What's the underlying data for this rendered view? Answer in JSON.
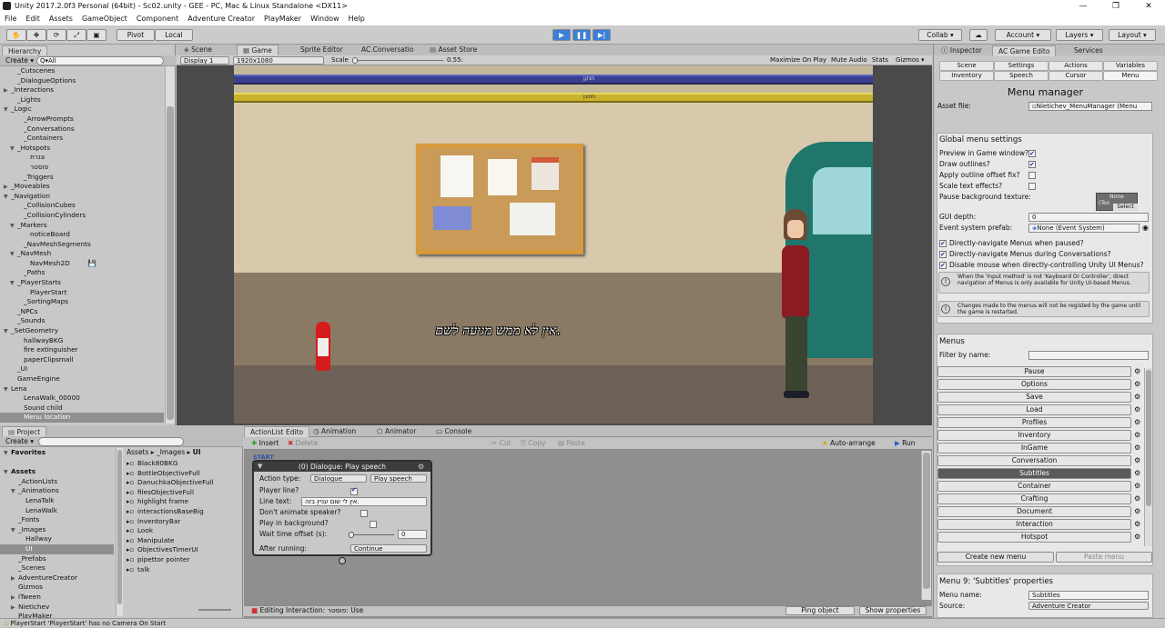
{
  "window": {
    "title": "Unity 2017.2.0f3 Personal (64bit) - Sc02.unity - GEE - PC, Mac & Linux Standalone <DX11>",
    "minimize": "—",
    "maximize": "❐",
    "close": "✕"
  },
  "menubar": [
    "File",
    "Edit",
    "Assets",
    "GameObject",
    "Component",
    "Adventure Creator",
    "PlayMaker",
    "Window",
    "Help"
  ],
  "toolbar": {
    "pivot": "Pivot",
    "local": "Local",
    "collab": "Collab ▾",
    "account": "Account ▾",
    "layers": "Layers ▾",
    "layout": "Layout ▾"
  },
  "hierarchy": {
    "tab": "Hierarchy",
    "create": "Create ▾",
    "search_placeholder": "Q▾All",
    "items": [
      {
        "indent": 1,
        "arrow": "",
        "label": "_Cutscenes"
      },
      {
        "indent": 1,
        "arrow": "",
        "label": "_DialogueOptions"
      },
      {
        "indent": 0,
        "arrow": "▶",
        "label": "_Interactions"
      },
      {
        "indent": 1,
        "arrow": "",
        "label": "_Lights"
      },
      {
        "indent": 0,
        "arrow": "▼",
        "label": "_Logic"
      },
      {
        "indent": 2,
        "arrow": "",
        "label": "_ArrowPrompts"
      },
      {
        "indent": 2,
        "arrow": "",
        "label": "_Conversations"
      },
      {
        "indent": 2,
        "arrow": "",
        "label": "_Containers"
      },
      {
        "indent": 1,
        "arrow": "▼",
        "label": "_Hotspots"
      },
      {
        "indent": 3,
        "arrow": "",
        "label": "צנרת"
      },
      {
        "indent": 3,
        "arrow": "",
        "label": "פוסטר"
      },
      {
        "indent": 2,
        "arrow": "",
        "label": "_Triggers"
      },
      {
        "indent": 0,
        "arrow": "▶",
        "label": "_Moveables"
      },
      {
        "indent": 0,
        "arrow": "▼",
        "label": "_Navigation"
      },
      {
        "indent": 2,
        "arrow": "",
        "label": "_CollisionCubes"
      },
      {
        "indent": 2,
        "arrow": "",
        "label": "_CollisionCylinders"
      },
      {
        "indent": 1,
        "arrow": "▼",
        "label": "_Markers"
      },
      {
        "indent": 3,
        "arrow": "",
        "label": "noticeBoard"
      },
      {
        "indent": 2,
        "arrow": "",
        "label": "_NavMeshSegments"
      },
      {
        "indent": 1,
        "arrow": "▼",
        "label": "_NavMesh"
      },
      {
        "indent": 3,
        "arrow": "",
        "label": "NavMesh2D"
      },
      {
        "indent": 2,
        "arrow": "",
        "label": "_Paths"
      },
      {
        "indent": 1,
        "arrow": "▼",
        "label": "_PlayerStarts"
      },
      {
        "indent": 3,
        "arrow": "",
        "label": "PlayerStart"
      },
      {
        "indent": 2,
        "arrow": "",
        "label": "_SortingMaps"
      },
      {
        "indent": 1,
        "arrow": "",
        "label": "_NPCs"
      },
      {
        "indent": 1,
        "arrow": "",
        "label": "_Sounds"
      },
      {
        "indent": 0,
        "arrow": "▼",
        "label": "_SetGeometry"
      },
      {
        "indent": 2,
        "arrow": "",
        "label": "hallwayBKG"
      },
      {
        "indent": 2,
        "arrow": "",
        "label": "fire extinguisher"
      },
      {
        "indent": 2,
        "arrow": "",
        "label": "paperClipsmall"
      },
      {
        "indent": 1,
        "arrow": "",
        "label": "_UI"
      },
      {
        "indent": 1,
        "arrow": "",
        "label": "GameEngine"
      },
      {
        "indent": 0,
        "arrow": "▼",
        "label": "Lena"
      },
      {
        "indent": 2,
        "arrow": "",
        "label": "LenaWalk_00000"
      },
      {
        "indent": 2,
        "arrow": "",
        "label": "Sound child"
      },
      {
        "indent": 2,
        "arrow": "",
        "label": "Menu location"
      }
    ]
  },
  "scene_tabs": {
    "scene": "Scene",
    "game": "Game",
    "sprite_editor": "Sprite Editor",
    "ac_conversation": "AC.Conversatio",
    "asset_store": "Asset Store"
  },
  "game_toolbar": {
    "display": "Display 1",
    "resolution": "1920x1080",
    "scale_label": "Scale",
    "scale_value": "0.55:",
    "maximize": "Maximize On Play",
    "mute": "Mute Audio",
    "stats": "Stats",
    "gizmos": "Gizmos ▾"
  },
  "game_view": {
    "pipe_label_top": "חנקן",
    "pipe_label_bottom": "חמצן",
    "subtitle": "אין לא ממש מגיעה לשם."
  },
  "project": {
    "tab": "Project",
    "create": "Create ▾",
    "tree": [
      {
        "indent": 0,
        "arrow": "▼",
        "label": "Favorites",
        "bold": true
      },
      {
        "indent": 0,
        "arrow": "",
        "label": ""
      },
      {
        "indent": 0,
        "arrow": "▼",
        "label": "Assets",
        "bold": true
      },
      {
        "indent": 1,
        "arrow": "",
        "label": "_ActionLists"
      },
      {
        "indent": 1,
        "arrow": "▼",
        "label": "_Animations"
      },
      {
        "indent": 2,
        "arrow": "",
        "label": "LenaTalk"
      },
      {
        "indent": 2,
        "arrow": "",
        "label": "LenaWalk"
      },
      {
        "indent": 1,
        "arrow": "",
        "label": "_Fonts"
      },
      {
        "indent": 1,
        "arrow": "▼",
        "label": "_Images"
      },
      {
        "indent": 2,
        "arrow": "",
        "label": "Hallway"
      },
      {
        "indent": 2,
        "arrow": "",
        "label": "UI"
      },
      {
        "indent": 1,
        "arrow": "",
        "label": "_Prefabs"
      },
      {
        "indent": 1,
        "arrow": "",
        "label": "_Scenes"
      },
      {
        "indent": 1,
        "arrow": "▶",
        "label": "AdventureCreator"
      },
      {
        "indent": 1,
        "arrow": "",
        "label": "Gizmos"
      },
      {
        "indent": 1,
        "arrow": "▶",
        "label": "iTween"
      },
      {
        "indent": 1,
        "arrow": "▶",
        "label": "Nietichev"
      },
      {
        "indent": 1,
        "arrow": "",
        "label": "PlayMaker"
      }
    ],
    "breadcrumb": [
      "Assets",
      "_Images",
      "UI"
    ],
    "files": [
      "Black80BKG",
      "BottleObjectiveFull",
      "DanuchkaObjectiveFull",
      "filesObjectiveFull",
      "highlight frame",
      "interactionsBaseBig",
      "InventoryBar",
      "Look",
      "Manipulate",
      "ObjectivesTimerUI",
      "pipettor pointer",
      "talk"
    ]
  },
  "actionlist": {
    "tabs": [
      "ActionList Edito",
      "Animation",
      "Animator",
      "Console"
    ],
    "insert": "Insert",
    "delete": "Delete",
    "cut": "Cut",
    "copy": "Copy",
    "paste": "Paste",
    "auto_arrange": "Auto-arrange",
    "run": "Run",
    "start_label": "START",
    "node_title": "(0) Dialogue: Play speech",
    "action_type_label": "Action type:",
    "action_type_value": "Dialogue",
    "action_subtype_value": "Play speech",
    "player_line_label": "Player line?",
    "line_text_label": "Line text:",
    "line_text_value": "אין לי שום עניין בזה.",
    "dont_animate_label": "Don't animate speaker?",
    "background_label": "Play in background?",
    "wait_label": "Wait time offset (s):",
    "wait_value": "0",
    "after_label": "After running:",
    "after_value": "Continue",
    "status": "Editing Interaction: פוסטר: Use",
    "ping": "Ping object",
    "show_props": "Show properties"
  },
  "inspector": {
    "tabs": [
      "Inspector",
      "AC Game Edito",
      "Services"
    ],
    "sub_tabs_row1": [
      "Scene",
      "Settings",
      "Actions",
      "Variables"
    ],
    "sub_tabs_row2": [
      "Inventory",
      "Speech",
      "Cursor",
      "Menu"
    ],
    "heading": "Menu manager",
    "asset_file_label": "Asset file:",
    "asset_file_value": "Nietichev_MenuManager (Menu",
    "global_title": "Global menu settings",
    "checks": [
      {
        "label": "Preview in Game window?",
        "on": true
      },
      {
        "label": "Draw outlines?",
        "on": true
      },
      {
        "label": "Apply outline offset fix?",
        "on": false
      },
      {
        "label": "Scale text effects?",
        "on": false
      }
    ],
    "pause_bg_label": "Pause background texture:",
    "pause_none": "None",
    "pause_tex": "(Tex",
    "pause_select": "Select",
    "gui_depth_label": "GUI depth:",
    "gui_depth_value": "0",
    "event_prefab_label": "Event system prefab:",
    "event_prefab_value": "None (Event System)",
    "nav_checks": [
      {
        "label": "Directly-navigate Menus when paused?",
        "on": true
      },
      {
        "label": "Directly-navigate Menus during Conversations?",
        "on": true
      },
      {
        "label": "Disable mouse when directly-controlling Unity UI Menus?",
        "on": true
      }
    ],
    "info1": "When the 'Input method' is not 'Keyboard Or Controller', direct navigation of Menus is only available for Unity UI-based Menus.",
    "info2": "Changes made to the menus will not be registed by the game until the game is restarted.",
    "menus_title": "Menus",
    "filter_label": "Filter by name:",
    "menus": [
      "Pause",
      "Options",
      "Save",
      "Load",
      "Profiles",
      "Inventory",
      "InGame",
      "Conversation",
      "Subtitles",
      "Container",
      "Crafting",
      "Document",
      "Interaction",
      "Hotspot"
    ],
    "selected_menu": "Subtitles",
    "create_menu": "Create new menu",
    "paste_menu": "Paste menu",
    "props_title": "Menu 9: 'Subtitles' properties",
    "menu_name_label": "Menu name:",
    "menu_name_value": "Subtitles",
    "source_label": "Source:",
    "source_value": "Adventure Creator"
  },
  "statusbar": "PlayerStart 'PlayerStart' has no Camera On Start"
}
